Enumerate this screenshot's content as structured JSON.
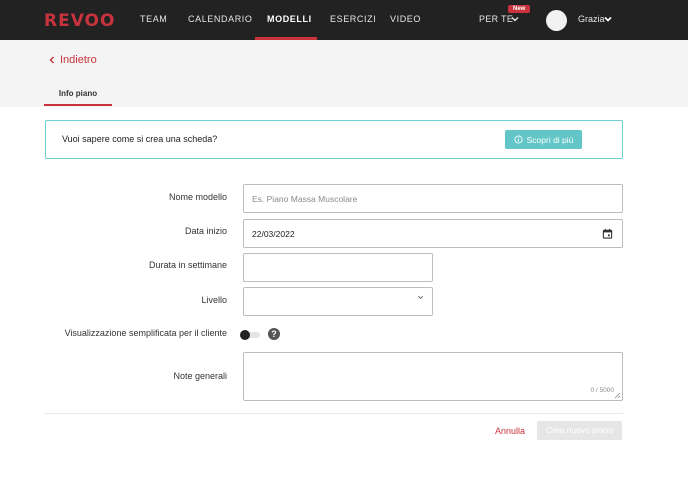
{
  "nav": {
    "logo": "REVOO",
    "items": [
      {
        "label": "TEAM"
      },
      {
        "label": "CALENDARIO"
      },
      {
        "label": "MODELLI"
      },
      {
        "label": "ESERCIZI"
      },
      {
        "label": "VIDEO"
      }
    ],
    "active_item": "MODELLI",
    "per_te": "PER TE",
    "new_badge": "New",
    "user_name": "Grazia"
  },
  "header": {
    "back_label": "Indietro",
    "tab_label": "Info piano"
  },
  "banner": {
    "text": "Vuoi sapere come si crea una scheda?",
    "button_label": "Scopri di più",
    "accent_color": "#62c5c7"
  },
  "form": {
    "nome_modello": {
      "label": "Nome modello",
      "value": "",
      "placeholder": "Es. Piano Massa Muscolare"
    },
    "data_inizio": {
      "label": "Data inizio",
      "value": "22/03/2022"
    },
    "durata": {
      "label": "Durata in settimane",
      "value": ""
    },
    "livello": {
      "label": "Livello",
      "value": ""
    },
    "visualizzazione": {
      "label": "Visualizzazione semplificata per il cliente",
      "enabled": false
    },
    "note": {
      "label": "Note generali",
      "value": "",
      "counter": "0 / 5000"
    }
  },
  "actions": {
    "cancel_label": "Annulla",
    "create_label": "Crea nuovo piano"
  },
  "colors": {
    "brand": "#c8333d",
    "topbar": "#222222"
  }
}
